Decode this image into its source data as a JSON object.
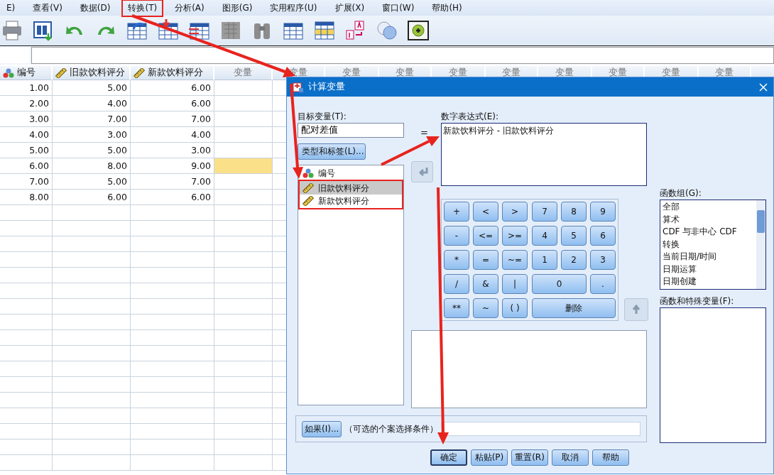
{
  "menu": [
    {
      "label": "E)",
      "marked": false
    },
    {
      "label": "查看(V)",
      "marked": false
    },
    {
      "label": "数据(D)",
      "marked": false
    },
    {
      "label": "转换(T)",
      "marked": true
    },
    {
      "label": "分析(A)",
      "marked": false
    },
    {
      "label": "图形(G)",
      "marked": false
    },
    {
      "label": "实用程序(U)",
      "marked": false
    },
    {
      "label": "扩展(X)",
      "marked": false
    },
    {
      "label": "窗口(W)",
      "marked": false
    },
    {
      "label": "帮助(H)",
      "marked": false
    }
  ],
  "grid": {
    "columns": [
      {
        "label": "编号",
        "kind": "nominal"
      },
      {
        "label": "旧款饮料评分",
        "kind": "scale"
      },
      {
        "label": "新款饮料评分",
        "kind": "scale"
      },
      {
        "label": "变量",
        "kind": "empty"
      },
      {
        "label": "变量",
        "kind": "empty"
      },
      {
        "label": "变量",
        "kind": "empty"
      },
      {
        "label": "变量",
        "kind": "empty"
      },
      {
        "label": "变量",
        "kind": "empty"
      },
      {
        "label": "变量",
        "kind": "empty"
      },
      {
        "label": "变量",
        "kind": "empty"
      },
      {
        "label": "变量",
        "kind": "empty"
      },
      {
        "label": "变量",
        "kind": "empty"
      },
      {
        "label": "变量",
        "kind": "empty"
      }
    ],
    "rows": [
      {
        "cells": [
          "1.00",
          "5.00",
          "6.00"
        ],
        "selected": false
      },
      {
        "cells": [
          "2.00",
          "4.00",
          "6.00"
        ],
        "selected": false
      },
      {
        "cells": [
          "3.00",
          "7.00",
          "7.00"
        ],
        "selected": false
      },
      {
        "cells": [
          "4.00",
          "3.00",
          "4.00"
        ],
        "selected": false
      },
      {
        "cells": [
          "5.00",
          "5.00",
          "3.00"
        ],
        "selected": false
      },
      {
        "cells": [
          "6.00",
          "8.00",
          "9.00"
        ],
        "selected": true
      },
      {
        "cells": [
          "7.00",
          "5.00",
          "7.00"
        ],
        "selected": false
      },
      {
        "cells": [
          "8.00",
          "6.00",
          "6.00"
        ],
        "selected": false
      }
    ]
  },
  "dialog": {
    "title": "计算变量",
    "target_label": "目标变量(T):",
    "target_value": "配对差值",
    "equals": "=",
    "type_button": "类型和标签(L)...",
    "expression_label": "数字表达式(E):",
    "expression": "新款饮料评分 - 旧款饮料评分",
    "variables": [
      {
        "name": "编号",
        "kind": "nominal",
        "selected": false,
        "marked": false
      },
      {
        "name": "旧款饮料评分",
        "kind": "scale",
        "selected": true,
        "marked": true
      },
      {
        "name": "新款饮料评分",
        "kind": "scale",
        "selected": false,
        "marked": true
      }
    ],
    "operators": [
      "+",
      "<",
      ">",
      "-",
      "<=",
      ">=",
      "*",
      "=",
      "~=",
      "/",
      "&",
      "|",
      "**",
      "~",
      "( )"
    ],
    "numbers": [
      {
        "label": "7",
        "kind": "key"
      },
      {
        "label": "8",
        "kind": "key"
      },
      {
        "label": "9",
        "kind": "key"
      },
      {
        "label": "4",
        "kind": "key"
      },
      {
        "label": "5",
        "kind": "key"
      },
      {
        "label": "6",
        "kind": "key"
      },
      {
        "label": "1",
        "kind": "key"
      },
      {
        "label": "2",
        "kind": "key"
      },
      {
        "label": "3",
        "kind": "key"
      },
      {
        "label": "0",
        "kind": "wide"
      },
      {
        "label": ".",
        "kind": "key"
      },
      {
        "label": "删除",
        "kind": "wider"
      }
    ],
    "function_group_label": "函数组(G):",
    "function_groups": [
      "全部",
      "算术",
      "CDF 与非中心 CDF",
      "转换",
      "当前日期/时间",
      "日期运算",
      "日期创建"
    ],
    "functions_label": "函数和特殊变量(F):",
    "if_button": "如果(I)...",
    "if_hint": "（可选的个案选择条件）",
    "buttons": [
      {
        "label": "确定",
        "default": true
      },
      {
        "label": "粘贴(P)",
        "default": false
      },
      {
        "label": "重置(R)",
        "default": false
      },
      {
        "label": "取消",
        "default": false
      },
      {
        "label": "帮助",
        "default": false
      }
    ]
  },
  "annotation_arrows": true
}
